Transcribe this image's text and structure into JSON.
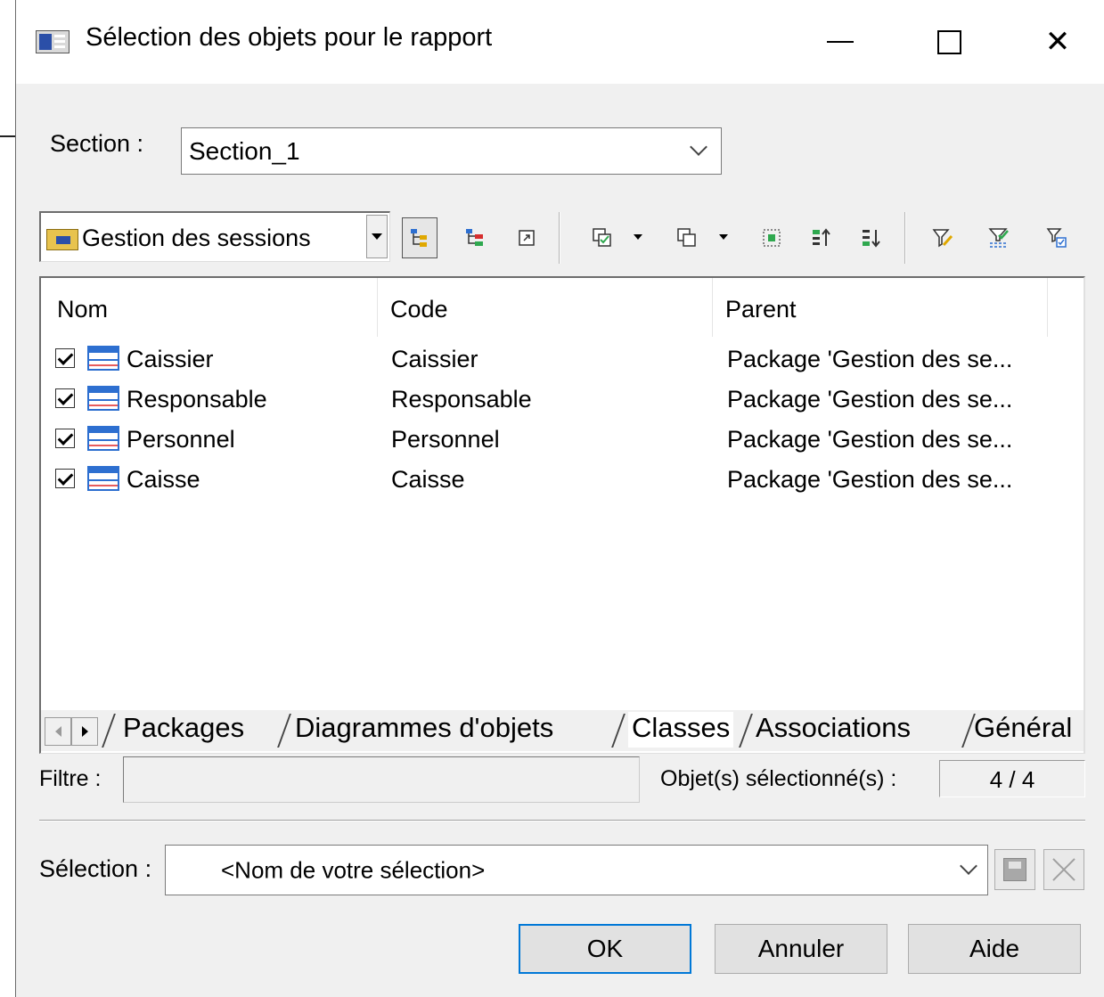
{
  "window": {
    "title": "Sélection des objets pour le rapport",
    "controls": {
      "minimize": "—",
      "maximize": "☐",
      "close": "✕"
    }
  },
  "section": {
    "label": "Section :",
    "value": "Section_1"
  },
  "toolbar": {
    "package_value": "Gestion des sessions",
    "icons": [
      "hierarchy-icon",
      "subpackage-icon",
      "shortcut-icon",
      "select-all-icon",
      "deselect-icon",
      "select-visible-icon",
      "move-up-icon",
      "move-down-icon",
      "filter-define-icon",
      "filter-selected-icon",
      "filter-apply-icon"
    ]
  },
  "list": {
    "columns": [
      "Nom",
      "Code",
      "Parent"
    ],
    "rows": [
      {
        "name": "Caissier",
        "code": "Caissier",
        "parent": "Package 'Gestion des se...",
        "checked": true
      },
      {
        "name": "Responsable",
        "code": "Responsable",
        "parent": "Package 'Gestion des se...",
        "checked": true
      },
      {
        "name": "Personnel",
        "code": "Personnel",
        "parent": "Package 'Gestion des se...",
        "checked": true
      },
      {
        "name": "Caisse",
        "code": "Caisse",
        "parent": "Package 'Gestion des se...",
        "checked": true
      }
    ]
  },
  "tabs": {
    "items": [
      "Packages",
      "Diagrammes d'objets",
      "Classes",
      "Associations",
      "Général"
    ],
    "active": "Classes"
  },
  "filter": {
    "label": "Filtre :",
    "value": ""
  },
  "selected_count": {
    "label": "Objet(s) sélectionné(s) :",
    "value": "4 / 4"
  },
  "selection": {
    "label": "Sélection :",
    "placeholder": "<Nom de votre sélection>"
  },
  "buttons": {
    "ok": "OK",
    "cancel": "Annuler",
    "help": "Aide"
  },
  "colors": {
    "dialog_bg": "#f0f0f0",
    "accent": "#0078d7",
    "class_icon": "#2d6fd0"
  }
}
